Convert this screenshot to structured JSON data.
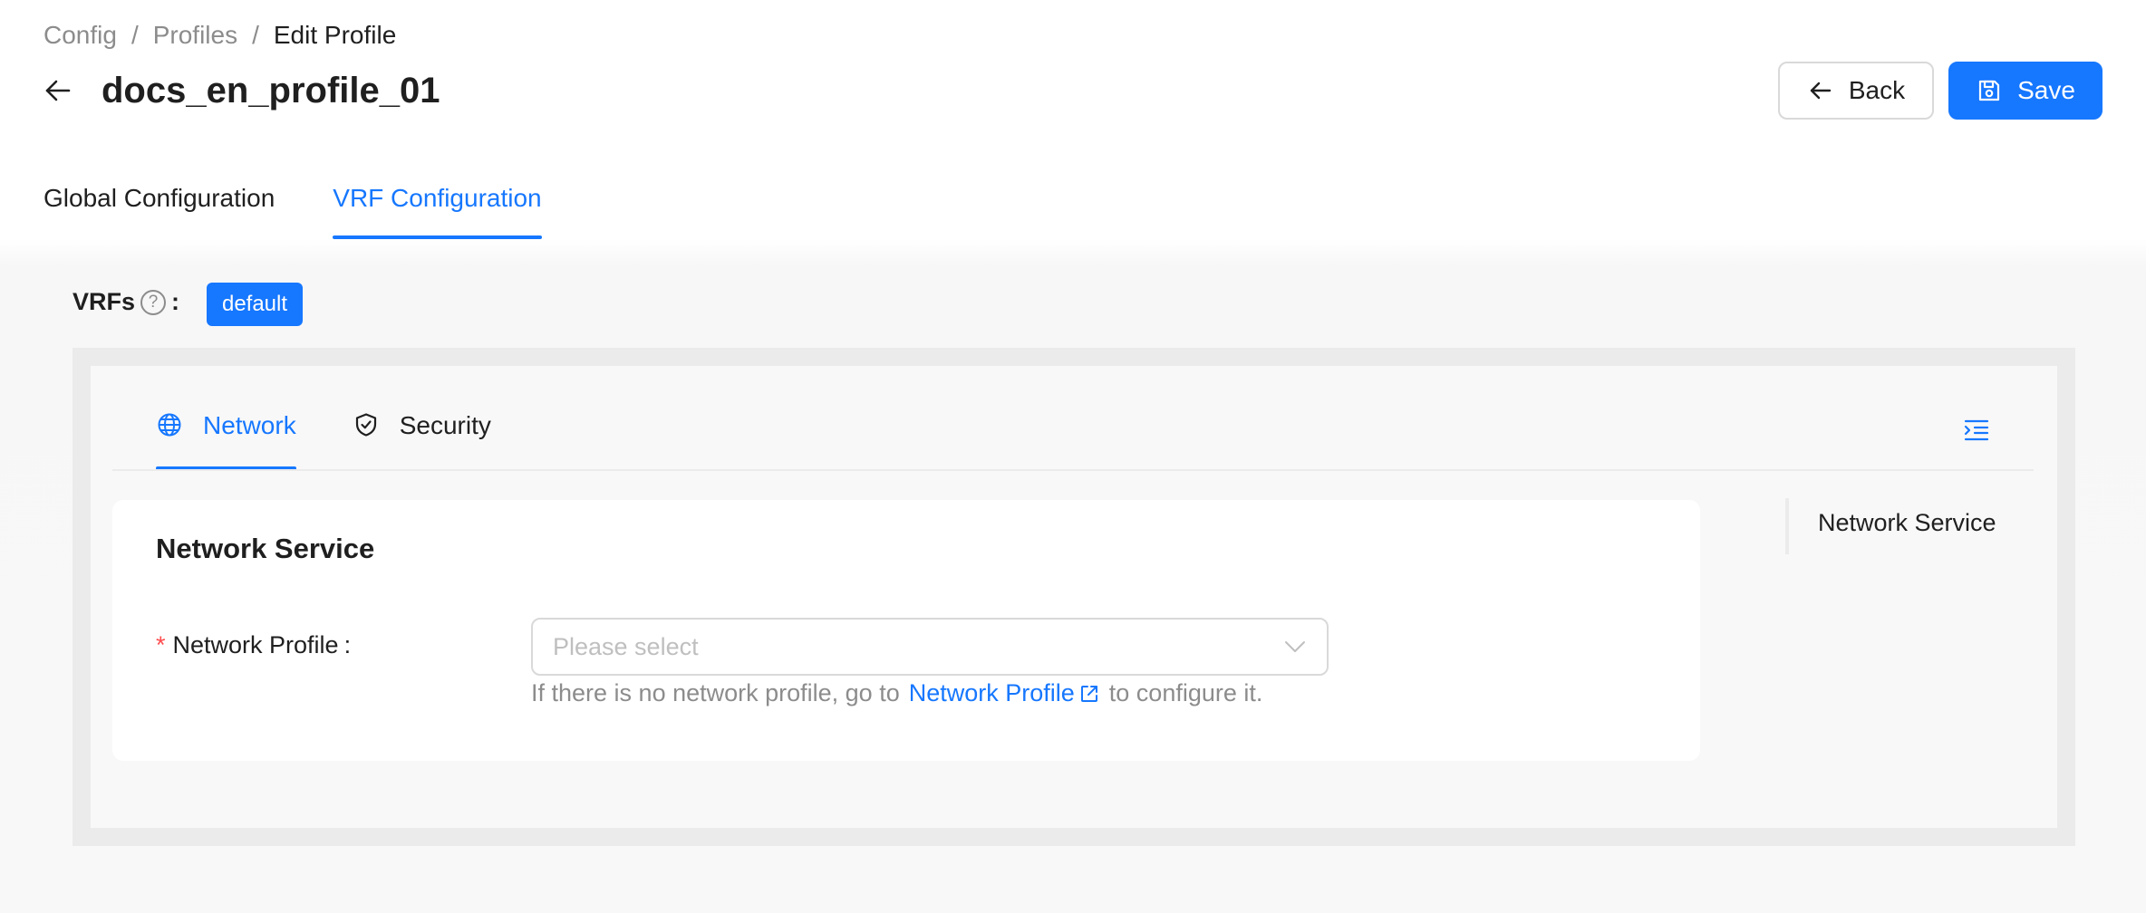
{
  "breadcrumb": {
    "items": [
      "Config",
      "Profiles",
      "Edit Profile"
    ],
    "separator": "/"
  },
  "header": {
    "title": "docs_en_profile_01",
    "back_button_label": "Back",
    "save_button_label": "Save"
  },
  "tabs": [
    {
      "label": "Global Configuration",
      "active": false
    },
    {
      "label": "VRF Configuration",
      "active": true
    }
  ],
  "vrfs": {
    "label": "VRFs",
    "help_icon_glyph": "?",
    "colon": ":",
    "tags": [
      "default"
    ]
  },
  "sub_tabs": [
    {
      "label": "Network",
      "icon": "globe-icon",
      "active": true
    },
    {
      "label": "Security",
      "icon": "shield-check-icon",
      "active": false
    }
  ],
  "form": {
    "section_title": "Network Service",
    "network_profile": {
      "required_mark": "*",
      "label": "Network Profile",
      "colon": ":",
      "placeholder": "Please select",
      "hint_prefix": "If there is no network profile, go to",
      "hint_link": "Network Profile",
      "hint_suffix": "to configure it."
    }
  },
  "anchor": {
    "items": [
      "Network Service"
    ]
  },
  "colors": {
    "primary": "#1677ff",
    "required": "#ff4d4f",
    "text": "#1f1f1f",
    "muted": "#8c8c8c"
  }
}
